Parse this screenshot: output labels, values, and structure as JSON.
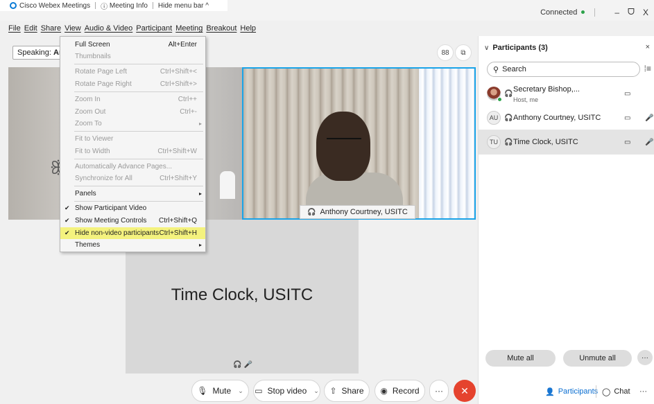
{
  "titlebar": {
    "app_name": "Cisco Webex Meetings",
    "meeting_info": "Meeting Info",
    "hide_menu_bar": "Hide menu bar ^",
    "status": "Connected",
    "minimize": "–",
    "restore": "ᗜ",
    "close": "X"
  },
  "menubar": [
    "File",
    "Edit",
    "Share",
    "View",
    "Audio & Video",
    "Participant",
    "Meeting",
    "Breakout",
    "Help"
  ],
  "stage": {
    "speaking_label": "Speaking:",
    "speaking_name": "Anth",
    "grid_icon": "88",
    "active_speaker_name": "Anthony Courtney, USITC",
    "tile_name": "Time Clock, USITC"
  },
  "view_menu": {
    "items": [
      {
        "label": "Full Screen",
        "shortcut": "Alt+Enter",
        "enabled": true
      },
      {
        "label": "Thumbnails",
        "shortcut": "",
        "enabled": false
      },
      {
        "label": "Rotate Page Left",
        "shortcut": "Ctrl+Shift+<",
        "enabled": false
      },
      {
        "label": "Rotate Page Right",
        "shortcut": "Ctrl+Shift+>",
        "enabled": false
      },
      {
        "label": "Zoom In",
        "shortcut": "Ctrl++",
        "enabled": false
      },
      {
        "label": "Zoom Out",
        "shortcut": "Ctrl+-",
        "enabled": false
      },
      {
        "label": "Zoom To",
        "shortcut": "",
        "enabled": false
      },
      {
        "label": "Fit to Viewer",
        "shortcut": "",
        "enabled": false
      },
      {
        "label": "Fit to Width",
        "shortcut": "Ctrl+Shift+W",
        "enabled": false
      },
      {
        "label": "Automatically Advance Pages...",
        "shortcut": "",
        "enabled": false
      },
      {
        "label": "Synchronize for All",
        "shortcut": "Ctrl+Shift+Y",
        "enabled": false
      },
      {
        "label": "Panels",
        "shortcut": "",
        "enabled": true
      },
      {
        "label": "Show Participant Video",
        "shortcut": "",
        "enabled": true,
        "checked": true
      },
      {
        "label": "Show Meeting Controls",
        "shortcut": "Ctrl+Shift+Q",
        "enabled": true,
        "checked": true
      },
      {
        "label": "Hide non-video participants",
        "shortcut": "Ctrl+Shift+H",
        "enabled": true,
        "checked": true
      },
      {
        "label": "Themes",
        "shortcut": "",
        "enabled": true
      }
    ]
  },
  "controls": {
    "mute": "Mute",
    "stop_video": "Stop video",
    "share": "Share",
    "record": "Record",
    "more": "···",
    "end": "✕"
  },
  "panel": {
    "title": "Participants (3)",
    "search_placeholder": "Search",
    "participants": [
      {
        "name": "Secretary Bishop,...",
        "role": "Host, me",
        "initials": ""
      },
      {
        "name": "Anthony Courtney, USITC",
        "role": "",
        "initials": "AU"
      },
      {
        "name": "Time Clock, USITC",
        "role": "",
        "initials": "TU"
      }
    ],
    "mute_all": "Mute all",
    "unmute_all": "Unmute all",
    "more": "···",
    "tab_participants": "Participants",
    "tab_chat": "Chat",
    "tab_more": "···"
  },
  "colors": {
    "accent": "#19a3e8",
    "end_call": "#e5432e",
    "highlight": "#f4f27e",
    "connected": "#2ca24a"
  }
}
